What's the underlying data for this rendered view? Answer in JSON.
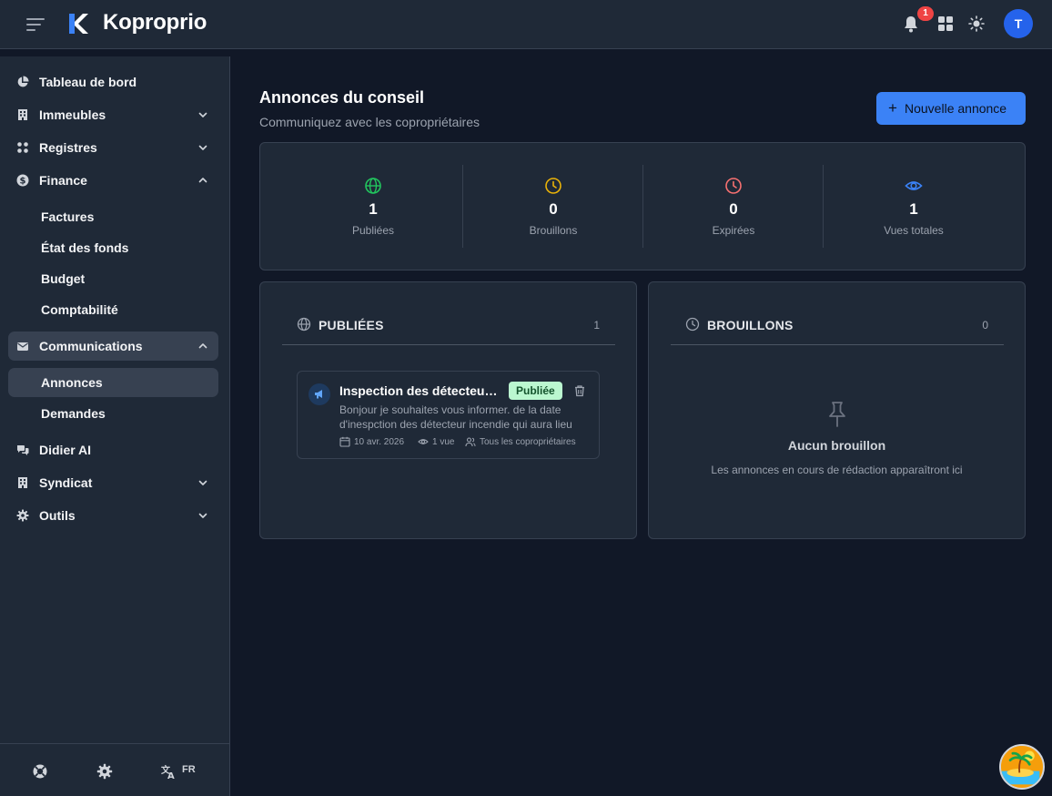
{
  "header": {
    "brand": "Koproprio",
    "notification_count": "1",
    "avatar_initial": "T"
  },
  "sidebar": {
    "items": {
      "dashboard": "Tableau de bord",
      "immeubles": "Immeubles",
      "registres": "Registres",
      "finance": "Finance",
      "factures": "Factures",
      "etat_fonds": "État des fonds",
      "budget": "Budget",
      "comptabilite": "Comptabilité",
      "communications": "Communications",
      "annonces": "Annonces",
      "demandes": "Demandes",
      "didier": "Didier AI",
      "syndicat": "Syndicat",
      "outils": "Outils"
    },
    "language": "FR"
  },
  "main": {
    "title": "Annonces du conseil",
    "subtitle": "Communiquez avec les copropriétaires",
    "new_button": "Nouvelle annonce",
    "stats": {
      "published_value": "1",
      "published_label": "Publiées",
      "drafts_value": "0",
      "drafts_label": "Brouillons",
      "expired_value": "0",
      "expired_label": "Expirées",
      "views_value": "1",
      "views_label": "Vues totales"
    },
    "published_panel": {
      "title": "PUBLIÉES",
      "count": "1"
    },
    "drafts_panel": {
      "title": "BROUILLONS",
      "count": "0",
      "empty_title": "Aucun brouillon",
      "empty_subtitle": "Les annonces en cours de rédaction apparaîtront ici"
    },
    "announcement": {
      "title": "Inspection des détecteurs incendie",
      "badge": "Publiée",
      "body": "Bonjour je souhaites vous informer. de la date d'inespction des détecteur incendie qui aura lieu",
      "date": "10 avr. 2026",
      "views": "1 vue",
      "audience": "Tous les copropriétaires"
    }
  },
  "colors": {
    "accent": "#3b82f6",
    "published_green": "#22c55e",
    "draft_yellow": "#eab308",
    "expired_red": "#f87171",
    "views_blue": "#3b82f6",
    "badge_bg": "#bbf7d0"
  }
}
